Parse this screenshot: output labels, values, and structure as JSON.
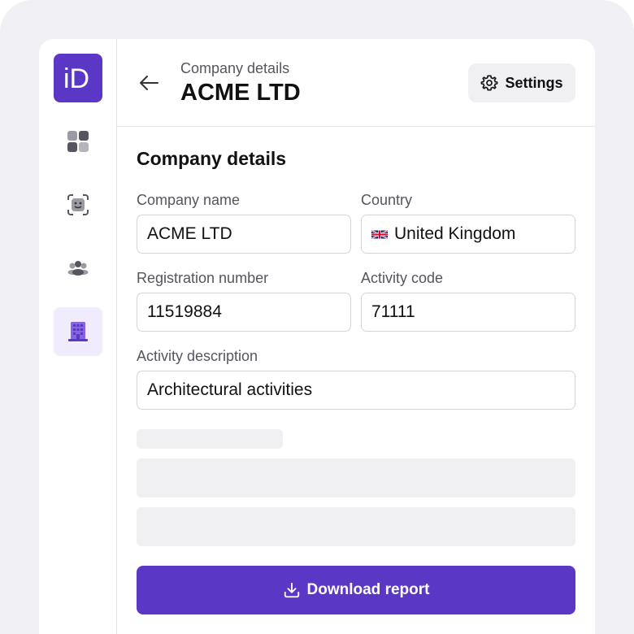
{
  "logo": {
    "text": "iD"
  },
  "sidebar": {
    "items": [
      {
        "name": "dashboard",
        "icon": "grid-icon"
      },
      {
        "name": "face-scan",
        "icon": "face-scan-icon"
      },
      {
        "name": "people",
        "icon": "users-icon"
      },
      {
        "name": "companies",
        "icon": "building-icon",
        "active": true
      }
    ]
  },
  "header": {
    "subtitle": "Company details",
    "title": "ACME LTD",
    "settings_label": "Settings"
  },
  "form": {
    "section_title": "Company details",
    "company_name": {
      "label": "Company name",
      "value": "ACME LTD"
    },
    "country": {
      "label": "Country",
      "value": "United Kingdom",
      "flag": "uk-flag-icon"
    },
    "registration_number": {
      "label": "Registration number",
      "value": "11519884"
    },
    "activity_code": {
      "label": "Activity code",
      "value": "71111"
    },
    "activity_description": {
      "label": "Activity description",
      "value": "Architectural activities"
    }
  },
  "download_label": "Download report",
  "colors": {
    "accent": "#5b37c6",
    "accent_light": "#f1ecfd",
    "background": "#f0f0f5",
    "text": "#111114",
    "muted": "#55555e"
  }
}
